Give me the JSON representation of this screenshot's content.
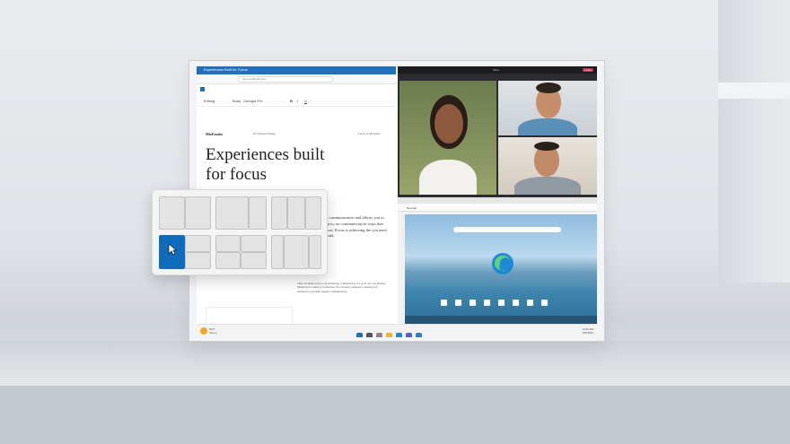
{
  "document_app": {
    "title": "Experiences Built for Focus",
    "address": "www.mixfonder.com",
    "toolbar": {
      "editing": "Editing",
      "style": "Body",
      "font": "Georgia Pro"
    },
    "brand": "MixFonder",
    "nav_center": "UX Aligned Design",
    "nav_right": "Focus & Simplicity",
    "headline": "Experiences built for focus",
    "paragraph": "More technology communicators and allows you to do what you want to, on communicate in ways that are not you to focus. Focus is achieving the you need to accomplish a task.",
    "body_text": "There are many ways to tap technology communicator is a good way you manage. Simplicity is a must: it is effortless. Not all needs confusion, capturing full attention for just their organic communication."
  },
  "video_call": {
    "title": "Meet",
    "leave_label": "Leave"
  },
  "browser": {
    "tab": "New tab"
  },
  "taskbar": {
    "weather_temp": "64°F",
    "weather_desc": "Sunny",
    "time": "11:11 AM",
    "date": "8/1/2021"
  },
  "colors": {
    "accent": "#0f6cbd",
    "title_bar": "#1f6fbf",
    "leave": "#c4314b"
  }
}
